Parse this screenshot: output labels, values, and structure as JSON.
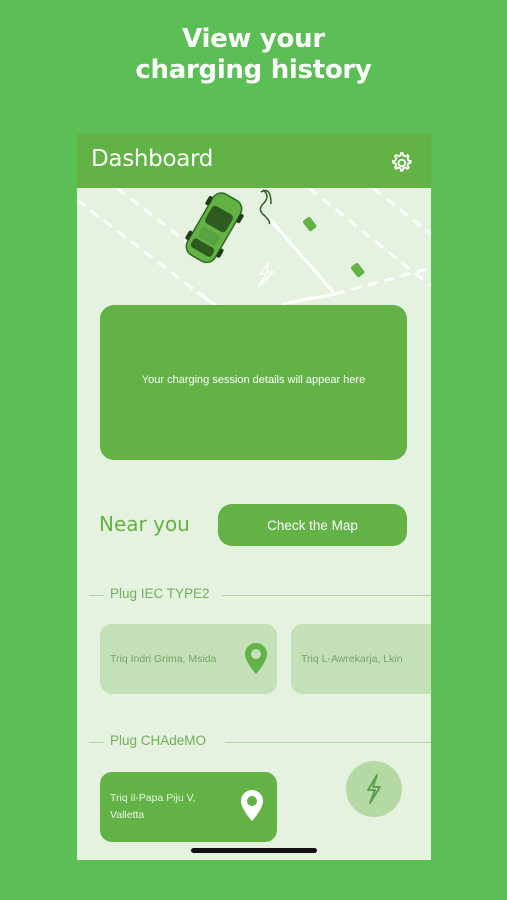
{
  "headline": {
    "line1": "View your",
    "line2": "charging history"
  },
  "appbar": {
    "title": "Dashboard",
    "settings_icon": "gear-icon"
  },
  "session": {
    "placeholder": "Your charging session details will appear here"
  },
  "near": {
    "label": "Near you",
    "map_button": "Check the Map"
  },
  "sections": [
    {
      "title": "Plug IEC TYPE2",
      "stations": [
        {
          "name": "Triq Indri Grima, Msida",
          "icon": "location-pin-icon"
        },
        {
          "name": "Triq L-Awrekarja, Lkin"
        }
      ]
    },
    {
      "title": "Plug CHAdeMO",
      "stations": [
        {
          "name_line1": "Triq il-Papa Piju V,",
          "name_line2": "Valletta",
          "icon": "location-pin-icon"
        }
      ],
      "action_icon": "lightning-bolt-icon"
    }
  ],
  "colors": {
    "background": "#5cbf55",
    "accent": "#62b246",
    "surface": "#e5f2df",
    "card_light": "#c4e0b8"
  }
}
